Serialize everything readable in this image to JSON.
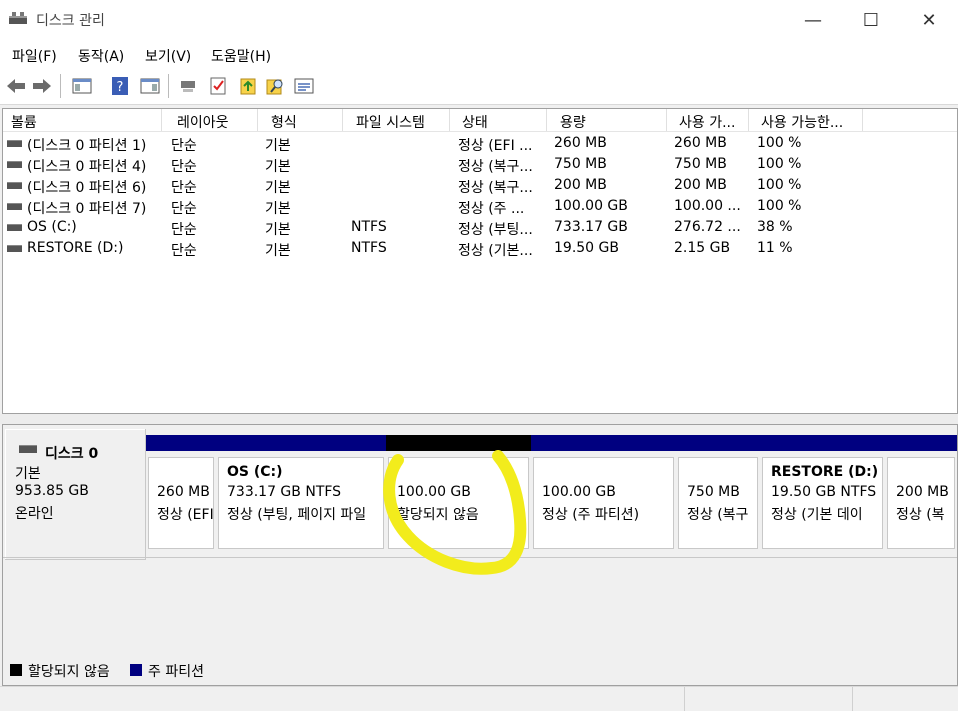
{
  "window": {
    "title": "디스크 관리",
    "min_glyph": "—",
    "max_glyph": "☐",
    "close_glyph": "✕"
  },
  "menu": [
    "파일(F)",
    "동작(A)",
    "보기(V)",
    "도움말(H)"
  ],
  "toolbar_icons": [
    "back-icon",
    "forward-icon",
    "show-hide-console-tree-icon",
    "help-icon",
    "show-hide-action-pane-icon",
    "connect-icon",
    "properties-icon",
    "export-icon",
    "search-icon",
    "settings-list-icon"
  ],
  "volume_list": {
    "columns": [
      "볼륨",
      "레이아웃",
      "형식",
      "파일 시스템",
      "상태",
      "용량",
      "사용 가...",
      "사용 가능한..."
    ],
    "rows": [
      [
        "(디스크 0 파티션 1)",
        "단순",
        "기본",
        "",
        "정상 (EFI ...",
        "260 MB",
        "260 MB",
        "100 %"
      ],
      [
        "(디스크 0 파티션 4)",
        "단순",
        "기본",
        "",
        "정상 (복구...",
        "750 MB",
        "750 MB",
        "100 %"
      ],
      [
        "(디스크 0 파티션 6)",
        "단순",
        "기본",
        "",
        "정상 (복구...",
        "200 MB",
        "200 MB",
        "100 %"
      ],
      [
        "(디스크 0 파티션 7)",
        "단순",
        "기본",
        "",
        "정상 (주 ...",
        "100.00 GB",
        "100.00 ...",
        "100 %"
      ],
      [
        "OS (C:)",
        "단순",
        "기본",
        "NTFS",
        "정상 (부팅...",
        "733.17 GB",
        "276.72 ...",
        "38 %"
      ],
      [
        "RESTORE (D:)",
        "단순",
        "기본",
        "NTFS",
        "정상 (기본...",
        "19.50 GB",
        "2.15 GB",
        "11 %"
      ]
    ]
  },
  "disk": {
    "name": "디스크 0",
    "type": "기본",
    "size": "953.85 GB",
    "status": "온라인",
    "partitions": [
      {
        "name": "",
        "size": "260 MB",
        "status": "정상 (EFI",
        "color": "#000080"
      },
      {
        "name": "OS  (C:)",
        "size": "733.17 GB NTFS",
        "status": "정상 (부팅, 페이지 파일",
        "color": "#000080"
      },
      {
        "name": "",
        "size": "100.00 GB",
        "status": "할당되지 않음",
        "color": "#000000"
      },
      {
        "name": "",
        "size": "100.00 GB",
        "status": "정상 (주 파티션)",
        "color": "#000080"
      },
      {
        "name": "",
        "size": "750 MB",
        "status": "정상 (복구",
        "color": "#000080"
      },
      {
        "name": "RESTORE  (D:)",
        "size": "19.50 GB NTFS",
        "status": "정상 (기본 데이",
        "color": "#000080"
      },
      {
        "name": "",
        "size": "200 MB",
        "status": "정상 (복",
        "color": "#000080"
      }
    ]
  },
  "legend": [
    {
      "label": "할당되지 않음",
      "color": "#000000"
    },
    {
      "label": "주 파티션",
      "color": "#000080"
    }
  ],
  "annotation": {
    "color": "#f2ec1c"
  }
}
